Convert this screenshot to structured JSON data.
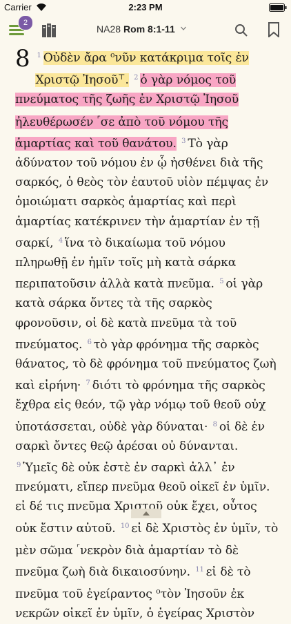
{
  "status": {
    "carrier": "Carrier",
    "time": "2:23 PM"
  },
  "toolbar": {
    "badge": "2",
    "version": "NA28",
    "passage": "Rom 8:1-11"
  },
  "text": {
    "chapter": "8",
    "v1": "1",
    "v1a": "Οὐδὲν ἄρα",
    "v1mark": "ο",
    "v1b": "νῦν κατάκριμα τοῖς ἐν Χριστῷ Ἰησοῦ",
    "v1mark2": "⊤",
    "v1c": ".",
    "v2": "2",
    "v2a": "ὁ γὰρ νόμος τοῦ πνεύματος τῆς ζωῆς ἐν Χριστῷ Ἰησοῦ ἠλευθέρωσέν",
    "v2mark": "⌜",
    "v2b": "σε ἀπὸ τοῦ νόμου τῆς ἁμαρτίας καὶ τοῦ θανάτου.",
    "v3": "3",
    "v3a": "Τὸ γὰρ ἀδύνατον τοῦ νόμου ἐν ᾧ ἠσθένει διὰ τῆς σαρκός, ὁ θεὸς τὸν ἑαυτοῦ υἱὸν πέμψας ἐν ὁμοιώματι σαρκὸς ἁμαρτίας καὶ περὶ ἁμαρτίας κατέκρινεν τὴν ἁμαρτίαν ἐν τῇ σαρκί,",
    "v4": "4",
    "v4a": "ἵνα τὸ δικαίωμα τοῦ νόμου πληρωθῇ ἐν ἡμῖν τοῖς μὴ κατὰ σάρκα περιπατοῦσιν ἀλλὰ κατὰ πνεῦμα.",
    "v5": "5",
    "v5a": "οἱ γὰρ κατὰ σάρκα ὄντες τὰ τῆς σαρκὸς φρονοῦσιν, οἱ δὲ κατὰ πνεῦμα τὰ τοῦ πνεύματος.",
    "v6": "6",
    "v6a": "τὸ γὰρ φρόνημα τῆς σαρκὸς θάνατος, τὸ δὲ φρόνημα τοῦ πνεύματος ζωὴ καὶ εἰρήνη·",
    "v7": "7",
    "v7a": "διότι τὸ φρόνημα τῆς σαρκὸς ἔχθρα εἰς θεόν, τῷ γὰρ νόμῳ τοῦ θεοῦ οὐχ ὑποτάσσεται, οὐδὲ γὰρ δύναται·",
    "v8": "8",
    "v8a": "οἱ δὲ ἐν σαρκὶ ὄντες θεῷ ἀρέσαι οὐ δύνανται.",
    "v9": "9",
    "v9a": "Ὑμεῖς δὲ οὐκ ἐστὲ ἐν σαρκὶ ἀλλ᾽ ἐν πνεύματι, εἴπερ πνεῦμα θεοῦ οἰκεῖ ἐν ὑμῖν. εἰ δέ τις πνεῦμα Χριστοῦ οὐκ ἔχει, οὗτος οὐκ ἔστιν αὐτοῦ.",
    "v10": "10",
    "v10a": "εἰ δὲ Χριστὸς ἐν ὑμῖν, τὸ μὲν σῶμα",
    "v10mark": "⌜",
    "v10b": "νεκρὸν διὰ ἁμαρτίαν τὸ δὲ πνεῦμα ζωὴ διὰ δικαιοσύνην.",
    "v11": "11",
    "v11a": "εἰ δὲ τὸ πνεῦμα τοῦ ἐγείραντος",
    "v11mark": "ο",
    "v11b": "τὸν Ἰησοῦν ἐκ νεκρῶν οἰκεῖ ἐν ὑμῖν, ὁ ἐγείρας Χριστὸν"
  },
  "colors": {
    "highlight_yellow": "#fbe79a",
    "highlight_pink": "#f8a6c4",
    "menu_green": "#6d9a3a",
    "badge": "#7b5aa6"
  },
  "icons": [
    "menu-icon",
    "library-icon",
    "chevron-down-icon",
    "search-icon",
    "bookmark-icon",
    "wifi-icon",
    "battery-icon",
    "chevron-up-icon"
  ]
}
